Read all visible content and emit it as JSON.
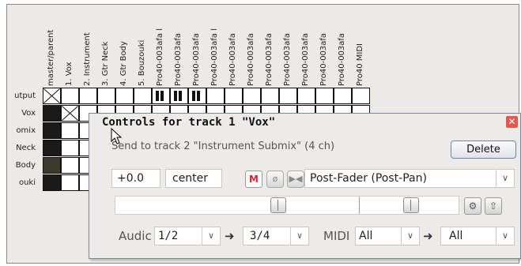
{
  "matrix": {
    "column_headers": [
      "master/parent",
      "1. Vox",
      "2. Instrument",
      "3. Gtr Neck",
      "4. Gtr Body",
      "5. Bouzouki",
      "Pro40-003afa l",
      "Pro40-003afa",
      "Pro40-003afa",
      "Pro40-003afa l",
      "Pro40-003afa",
      "Pro40-003afa",
      "Pro40-003afa",
      "Pro40-003afa",
      "Pro40-003afa",
      "Pro40-003afa",
      "Pro40-003afa",
      "Pro40 MIDI"
    ],
    "row_labels": [
      "utput",
      "Vox",
      "omix",
      "Neck",
      "Body",
      "ouki"
    ]
  },
  "dialog": {
    "title": "Controls for track 1 \"Vox\"",
    "close_glyph": "✕",
    "send_text": "Send to track 2 \"Instrument Submix\" (4 ch)",
    "delete_label": "Delete",
    "volume_value": "+0.0",
    "pan_value": "center",
    "mute_label": "M",
    "phase_glyph": "ø",
    "mono_glyph": "▶◀",
    "mode_select": "Post-Fader (Post-Pan)",
    "env_glyph": "⚙",
    "up_glyph": "⇧",
    "audio_label": "Audic",
    "audio_src": "1/2",
    "audio_dst": "3/4",
    "midi_label": "MIDI",
    "midi_src": "All",
    "midi_dst": "All",
    "arrow_glyph": "➜",
    "caret_glyph": "∨"
  }
}
